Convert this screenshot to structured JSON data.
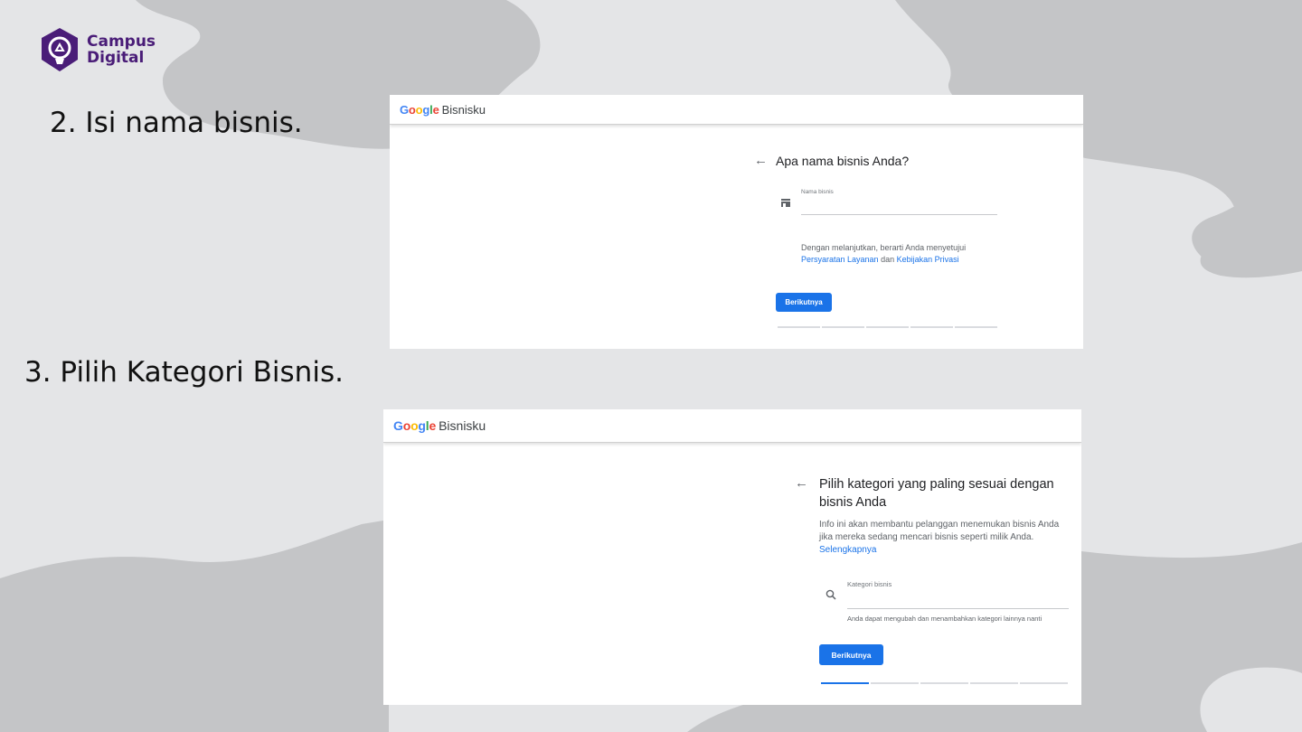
{
  "brand": {
    "logo_line1": "Campus",
    "logo_line2": "Digital",
    "color": "#4a1d78"
  },
  "steps": [
    {
      "label": "2. Isi nama bisnis.",
      "screenshot": {
        "header": {
          "google": "Google",
          "product": "Bisnisku"
        },
        "title": "Apa nama bisnis Anda?",
        "field_label": "Nama bisnis",
        "field_icon": "storefront-icon",
        "terms_line1": "Dengan melanjutkan, berarti Anda menyetujui",
        "terms_link1": "Persyaratan Layanan",
        "terms_and": "dan",
        "terms_link2": "Kebijakan Privasi",
        "button": "Berikutnya",
        "progress_segments": 5,
        "progress_active": 0
      }
    },
    {
      "label": "3. Pilih Kategori Bisnis.",
      "screenshot": {
        "header": {
          "google": "Google",
          "product": "Bisnisku"
        },
        "title_line1": "Pilih kategori yang paling sesuai dengan",
        "title_line2": "bisnis Anda",
        "info_line1": "Info ini akan membantu pelanggan menemukan bisnis Anda",
        "info_line2": "jika mereka sedang mencari bisnis seperti milik Anda.",
        "info_link": "Selengkapnya",
        "field_label": "Kategori bisnis",
        "field_icon": "search-icon",
        "helper": "Anda dapat mengubah dan menambahkan kategori lainnya nanti",
        "button": "Berikutnya",
        "progress_segments": 5,
        "progress_active": 1
      }
    }
  ],
  "colors": {
    "background": "#e4e5e7",
    "blob": "#c4c5c7",
    "accent": "#1a73e8"
  }
}
